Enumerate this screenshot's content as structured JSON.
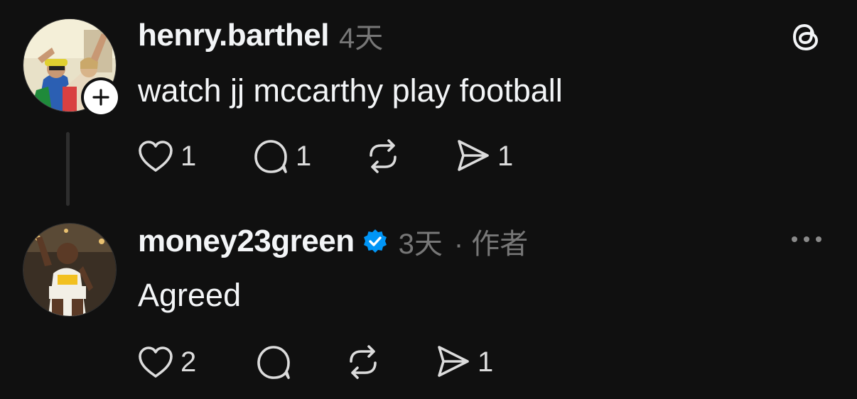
{
  "posts": [
    {
      "username": "henry.barthel",
      "time": "4天",
      "text": "watch jj mccarthy play football",
      "likes": "1",
      "replies": "1",
      "reposts": "",
      "shares": "1",
      "avatar_icon": "profile-photo",
      "follow_icon": "plus-icon"
    },
    {
      "username": "money23green",
      "verified": true,
      "time": "3天",
      "role": "· 作者",
      "text": "Agreed",
      "likes": "2",
      "replies": "",
      "reposts": "",
      "shares": "1",
      "avatar_icon": "profile-photo"
    }
  ],
  "icons": {
    "brand": "threads-logo-icon",
    "menu": "more-options-icon",
    "like": "heart-icon",
    "reply": "comment-icon",
    "repost": "repost-icon",
    "share": "share-icon",
    "verified": "verified-badge-icon"
  },
  "colors": {
    "background": "#101010",
    "text_primary": "#f3f5f7",
    "text_secondary": "#777777",
    "verified_blue": "#0095f6"
  }
}
